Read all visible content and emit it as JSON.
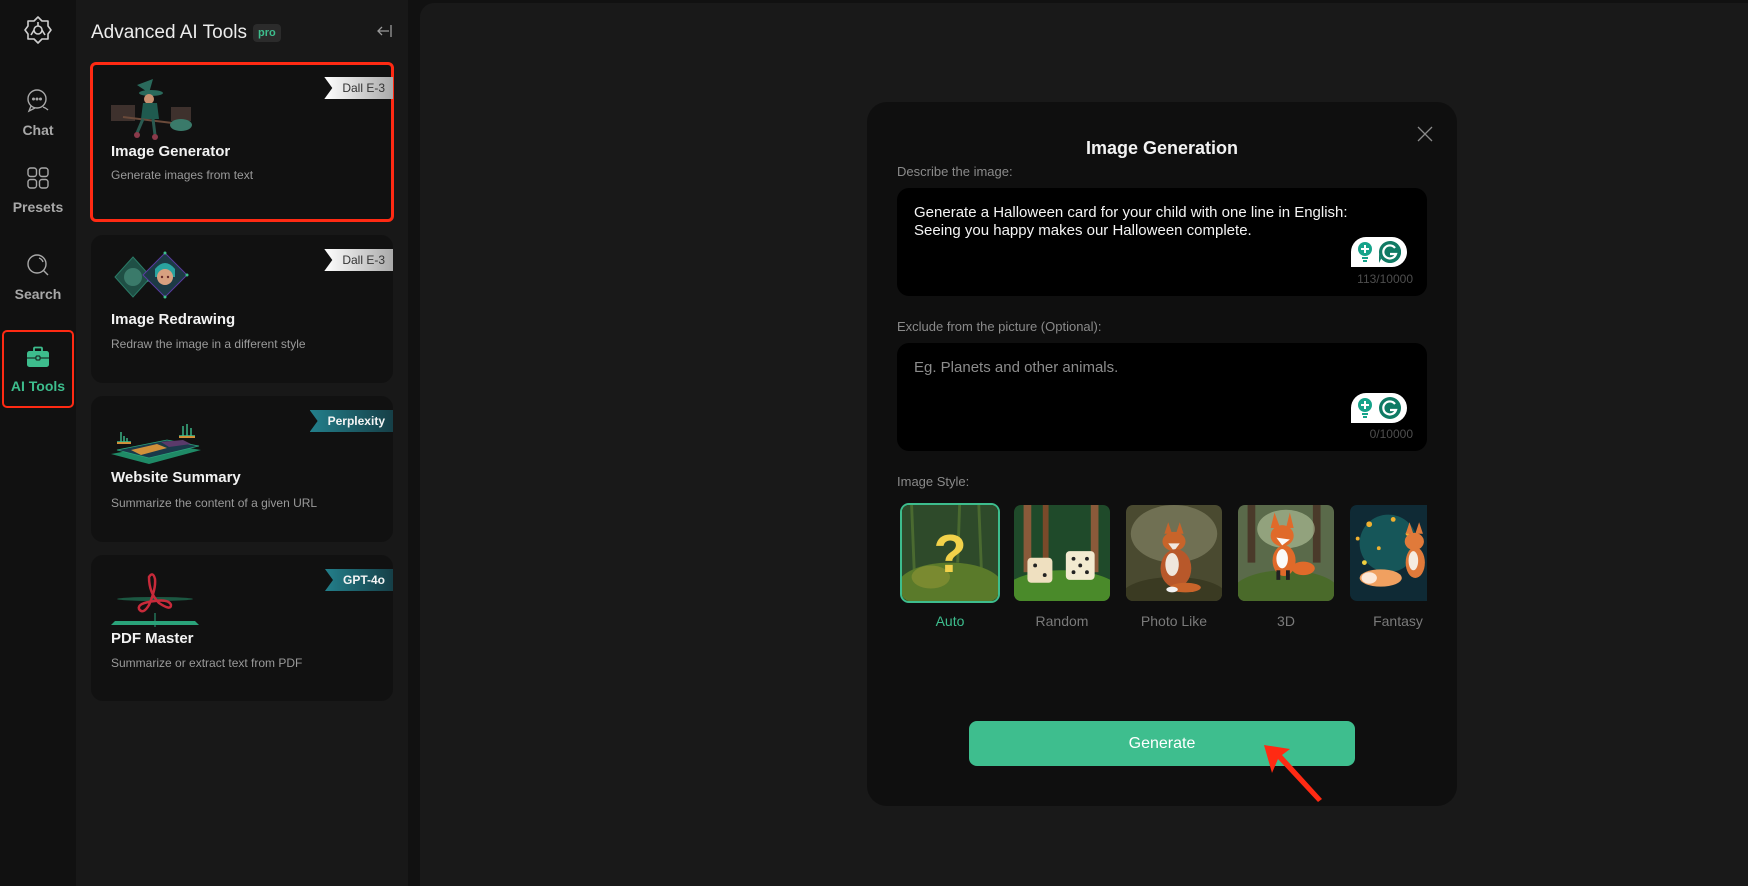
{
  "sidebar": {
    "logo_icon": "gear-flower-logo-icon",
    "items": [
      {
        "label": "Chat",
        "icon": "chat-bubble-icon",
        "active": false
      },
      {
        "label": "Presets",
        "icon": "grid-icon",
        "active": false
      },
      {
        "label": "Search",
        "icon": "search-icon",
        "active": false
      },
      {
        "label": "AI Tools",
        "icon": "toolbox-icon",
        "active": true
      }
    ]
  },
  "panel": {
    "title": "Advanced AI Tools",
    "pro_badge": "pro",
    "collapse_icon": "collapse-left-icon",
    "cards": [
      {
        "title": "Image Generator",
        "desc": "Generate images from text",
        "badge": "Dall E-3",
        "badge_style": "silver",
        "selected": true
      },
      {
        "title": "Image Redrawing",
        "desc": "Redraw the image in a different style",
        "badge": "Dall E-3",
        "badge_style": "silver",
        "selected": false
      },
      {
        "title": "Website Summary",
        "desc": "Summarize the content of a given URL",
        "badge": "Perplexity",
        "badge_style": "teal",
        "selected": false
      },
      {
        "title": "PDF Master",
        "desc": "Summarize or extract text from PDF",
        "badge": "GPT-4o",
        "badge_style": "teal",
        "selected": false
      }
    ]
  },
  "modal": {
    "title": "Image Generation",
    "describe": {
      "label": "Describe the image:",
      "value": "Generate a Halloween card for your child with one line in English: Seeing you happy makes our Halloween complete.",
      "counter": "113/10000"
    },
    "exclude": {
      "label": "Exclude from the picture (Optional):",
      "placeholder": "Eg. Planets and other animals.",
      "value": "",
      "counter": "0/10000"
    },
    "style": {
      "label": "Image Style:",
      "selected": "Auto",
      "options": [
        {
          "label": "Auto"
        },
        {
          "label": "Random"
        },
        {
          "label": "Photo Like"
        },
        {
          "label": "3D"
        },
        {
          "label": "Fantasy"
        }
      ]
    },
    "generate_label": "Generate"
  },
  "colors": {
    "accent": "#3ebe8e",
    "highlight": "#ff2a13",
    "sidebar_bg": "#111111",
    "panel_bg": "#181818",
    "main_bg": "#191919",
    "modal_bg": "#0f0f0f"
  }
}
